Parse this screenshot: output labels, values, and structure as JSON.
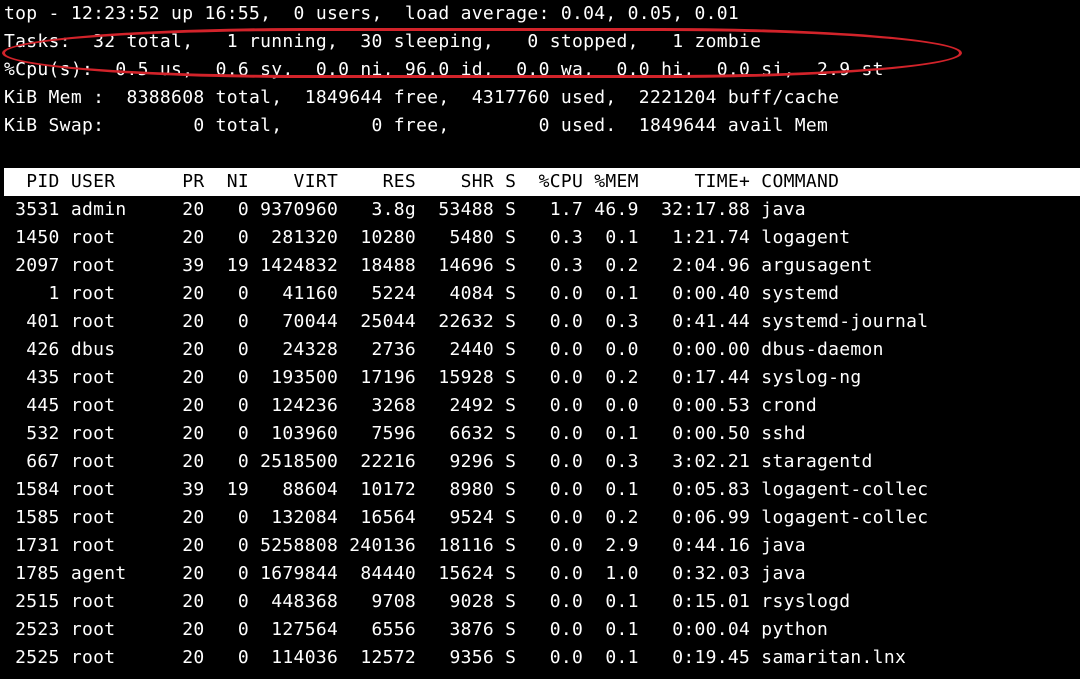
{
  "summary": {
    "top_line": "top - 12:23:52 up 16:55,  0 users,  load average: 0.04, 0.05, 0.01",
    "tasks_line": "Tasks:  32 total,   1 running,  30 sleeping,   0 stopped,   1 zombie",
    "cpu_line": "%Cpu(s):  0.5 us,  0.6 sy,  0.0 ni, 96.0 id,  0.0 wa,  0.0 hi,  0.0 si,  2.9 st",
    "mem_line": "KiB Mem :  8388608 total,  1849644 free,  4317760 used,  2221204 buff/cache",
    "swap_line": "KiB Swap:        0 total,        0 free,        0 used.  1849644 avail Mem"
  },
  "header": {
    "cols": "  PID USER      PR  NI    VIRT    RES    SHR S  %CPU %MEM     TIME+ COMMAND                          "
  },
  "processes": [
    {
      "pid": "3531",
      "user": "admin",
      "pr": "20",
      "ni": "0",
      "virt": "9370960",
      "res": "3.8g",
      "shr": "53488",
      "s": "S",
      "cpu": "1.7",
      "mem": "46.9",
      "time": "32:17.88",
      "cmd": "java"
    },
    {
      "pid": "1450",
      "user": "root",
      "pr": "20",
      "ni": "0",
      "virt": "281320",
      "res": "10280",
      "shr": "5480",
      "s": "S",
      "cpu": "0.3",
      "mem": "0.1",
      "time": "1:21.74",
      "cmd": "logagent"
    },
    {
      "pid": "2097",
      "user": "root",
      "pr": "39",
      "ni": "19",
      "virt": "1424832",
      "res": "18488",
      "shr": "14696",
      "s": "S",
      "cpu": "0.3",
      "mem": "0.2",
      "time": "2:04.96",
      "cmd": "argusagent"
    },
    {
      "pid": "1",
      "user": "root",
      "pr": "20",
      "ni": "0",
      "virt": "41160",
      "res": "5224",
      "shr": "4084",
      "s": "S",
      "cpu": "0.0",
      "mem": "0.1",
      "time": "0:00.40",
      "cmd": "systemd"
    },
    {
      "pid": "401",
      "user": "root",
      "pr": "20",
      "ni": "0",
      "virt": "70044",
      "res": "25044",
      "shr": "22632",
      "s": "S",
      "cpu": "0.0",
      "mem": "0.3",
      "time": "0:41.44",
      "cmd": "systemd-journal"
    },
    {
      "pid": "426",
      "user": "dbus",
      "pr": "20",
      "ni": "0",
      "virt": "24328",
      "res": "2736",
      "shr": "2440",
      "s": "S",
      "cpu": "0.0",
      "mem": "0.0",
      "time": "0:00.00",
      "cmd": "dbus-daemon"
    },
    {
      "pid": "435",
      "user": "root",
      "pr": "20",
      "ni": "0",
      "virt": "193500",
      "res": "17196",
      "shr": "15928",
      "s": "S",
      "cpu": "0.0",
      "mem": "0.2",
      "time": "0:17.44",
      "cmd": "syslog-ng"
    },
    {
      "pid": "445",
      "user": "root",
      "pr": "20",
      "ni": "0",
      "virt": "124236",
      "res": "3268",
      "shr": "2492",
      "s": "S",
      "cpu": "0.0",
      "mem": "0.0",
      "time": "0:00.53",
      "cmd": "crond"
    },
    {
      "pid": "532",
      "user": "root",
      "pr": "20",
      "ni": "0",
      "virt": "103960",
      "res": "7596",
      "shr": "6632",
      "s": "S",
      "cpu": "0.0",
      "mem": "0.1",
      "time": "0:00.50",
      "cmd": "sshd"
    },
    {
      "pid": "667",
      "user": "root",
      "pr": "20",
      "ni": "0",
      "virt": "2518500",
      "res": "22216",
      "shr": "9296",
      "s": "S",
      "cpu": "0.0",
      "mem": "0.3",
      "time": "3:02.21",
      "cmd": "staragentd"
    },
    {
      "pid": "1584",
      "user": "root",
      "pr": "39",
      "ni": "19",
      "virt": "88604",
      "res": "10172",
      "shr": "8980",
      "s": "S",
      "cpu": "0.0",
      "mem": "0.1",
      "time": "0:05.83",
      "cmd": "logagent-collec"
    },
    {
      "pid": "1585",
      "user": "root",
      "pr": "20",
      "ni": "0",
      "virt": "132084",
      "res": "16564",
      "shr": "9524",
      "s": "S",
      "cpu": "0.0",
      "mem": "0.2",
      "time": "0:06.99",
      "cmd": "logagent-collec"
    },
    {
      "pid": "1731",
      "user": "root",
      "pr": "20",
      "ni": "0",
      "virt": "5258808",
      "res": "240136",
      "shr": "18116",
      "s": "S",
      "cpu": "0.0",
      "mem": "2.9",
      "time": "0:44.16",
      "cmd": "java"
    },
    {
      "pid": "1785",
      "user": "agent",
      "pr": "20",
      "ni": "0",
      "virt": "1679844",
      "res": "84440",
      "shr": "15624",
      "s": "S",
      "cpu": "0.0",
      "mem": "1.0",
      "time": "0:32.03",
      "cmd": "java"
    },
    {
      "pid": "2515",
      "user": "root",
      "pr": "20",
      "ni": "0",
      "virt": "448368",
      "res": "9708",
      "shr": "9028",
      "s": "S",
      "cpu": "0.0",
      "mem": "0.1",
      "time": "0:15.01",
      "cmd": "rsyslogd"
    },
    {
      "pid": "2523",
      "user": "root",
      "pr": "20",
      "ni": "0",
      "virt": "127564",
      "res": "6556",
      "shr": "3876",
      "s": "S",
      "cpu": "0.0",
      "mem": "0.1",
      "time": "0:00.04",
      "cmd": "python"
    },
    {
      "pid": "2525",
      "user": "root",
      "pr": "20",
      "ni": "0",
      "virt": "114036",
      "res": "12572",
      "shr": "9356",
      "s": "S",
      "cpu": "0.0",
      "mem": "0.1",
      "time": "0:19.45",
      "cmd": "samaritan.lnx"
    }
  ]
}
